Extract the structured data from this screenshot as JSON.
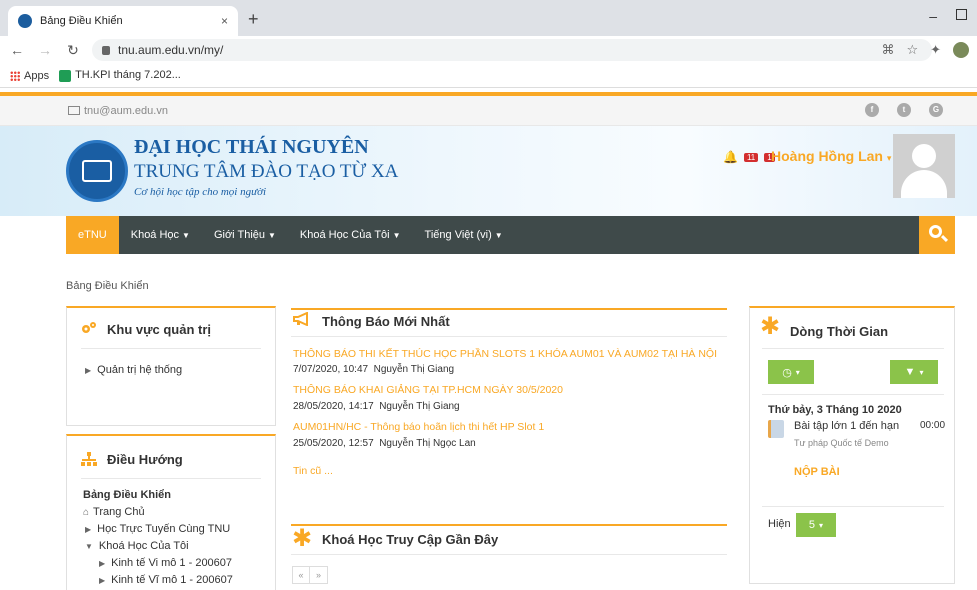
{
  "browser": {
    "tab_title": "Bảng Điều Khiển",
    "tab_close": "×",
    "new_tab": "+",
    "url": "tnu.aum.edu.vn/my/",
    "bookmarks": [
      "Apps",
      "TH.KPI tháng 7.202..."
    ]
  },
  "header": {
    "email": "tnu@aum.edu.vn",
    "uni_name": "ĐẠI HỌC THÁI NGUYÊN",
    "center_name": "TRUNG TÂM ĐÀO TẠO TỪ XA",
    "slogan": "Cơ hội học tập cho mọi người",
    "notif_count": "11",
    "msg_count": "1",
    "user_name": "Hoàng Hồng Lan",
    "social": [
      "f",
      "t",
      "G"
    ]
  },
  "nav": {
    "items": [
      {
        "label": "eTNU",
        "dropdown": false
      },
      {
        "label": "Khoá Học",
        "dropdown": true
      },
      {
        "label": "Giới Thiệu",
        "dropdown": true
      },
      {
        "label": "Khoá Học Của Tôi",
        "dropdown": true
      },
      {
        "label": "Tiếng Việt (vi)",
        "dropdown": true
      }
    ]
  },
  "breadcrumb": "Bảng Điều Khiển",
  "admin": {
    "title": "Khu vực quản trị",
    "item": "Quản trị hệ thống"
  },
  "navigation": {
    "title": "Điều Hướng",
    "root": "Bảng Điều Khiển",
    "home": "Trang Chủ",
    "items": [
      "Học Trực Tuyến Cùng TNU",
      "Khoá Học Của Tôi"
    ],
    "courses": [
      "Kinh tế Vi mô 1 - 200607",
      "Kinh tế Vĩ mô 1 - 200607"
    ]
  },
  "announcements": {
    "title": "Thông Báo Mới Nhất",
    "items": [
      {
        "title": "THÔNG BÁO THI KẾT THÚC HỌC PHẦN SLOTS 1 KHÓA AUM01 VÀ AUM02 TẠI HÀ NỘI",
        "date": "7/07/2020, 10:47",
        "author": "Nguyễn Thị Giang"
      },
      {
        "title": "THÔNG BÁO KHAI GIẢNG TẠI TP.HCM NGÀY 30/5/2020",
        "date": "28/05/2020, 14:17",
        "author": "Nguyễn Thị Giang"
      },
      {
        "title": "AUM01HN/HC - Thông báo hoãn lịch thi hết HP Slot 1",
        "date": "25/05/2020, 12:57",
        "author": "Nguyễn Thị Ngọc Lan"
      }
    ],
    "older": "Tin cũ ..."
  },
  "recent": {
    "title": "Khoá Học Truy Cập Gần Đây",
    "prev": "«",
    "next": "»"
  },
  "timeline": {
    "title": "Dòng Thời Gian",
    "date": "Thứ bảy, 3 Tháng 10 2020",
    "event": "Bài tập lớn 1 đến hạn",
    "time": "00:00",
    "course": "Tư pháp Quốc tế Demo",
    "action": "NỘP BÀI",
    "show_label": "Hiện",
    "show_value": "5"
  }
}
